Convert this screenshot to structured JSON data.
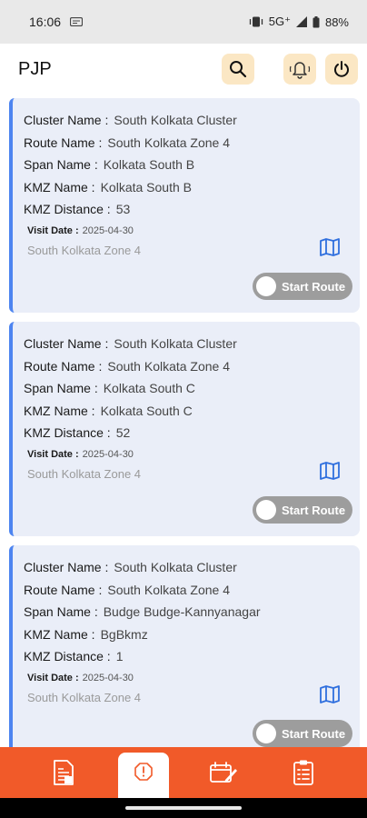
{
  "status": {
    "time": "16:06",
    "network": "5G⁺",
    "battery": "88%"
  },
  "app_bar": {
    "title": "PJP"
  },
  "cards": [
    {
      "cluster_label": "Cluster Name :",
      "cluster": "South Kolkata Cluster",
      "route_label": "Route Name :",
      "route": "South Kolkata Zone 4",
      "span_label": "Span Name :",
      "span": "Kolkata South B",
      "kmz_label": "KMZ Name :",
      "kmz": "Kolkata South B",
      "distance_label": "KMZ Distance :",
      "distance": "53",
      "visit_label": "Visit Date :",
      "visit_date": "2025-04-30",
      "zone": "South Kolkata Zone 4",
      "button": "Start Route"
    },
    {
      "cluster_label": "Cluster Name :",
      "cluster": "South Kolkata Cluster",
      "route_label": "Route Name :",
      "route": "South Kolkata Zone 4",
      "span_label": "Span Name :",
      "span": "Kolkata South C",
      "kmz_label": "KMZ Name :",
      "kmz": "Kolkata South C",
      "distance_label": "KMZ Distance :",
      "distance": "52",
      "visit_label": "Visit Date :",
      "visit_date": "2025-04-30",
      "zone": "South Kolkata Zone 4",
      "button": "Start Route"
    },
    {
      "cluster_label": "Cluster Name :",
      "cluster": "South Kolkata Cluster",
      "route_label": "Route Name :",
      "route": "South Kolkata Zone 4",
      "span_label": "Span Name :",
      "span": "Budge Budge-Kannyanagar",
      "kmz_label": "KMZ Name :",
      "kmz": "BgBkmz",
      "distance_label": "KMZ Distance :",
      "distance": "1",
      "visit_label": "Visit Date :",
      "visit_date": "2025-04-30",
      "zone": "South Kolkata Zone 4",
      "button": "Start Route"
    }
  ],
  "colors": {
    "accent": "#f15a29",
    "card_bg": "#eaeef8",
    "card_border": "#4d84f0",
    "icon_btn_bg": "#fbe7c4",
    "button_grey": "#9d9d9d"
  },
  "icons": {
    "search": "search-icon",
    "bell": "bell-icon",
    "power": "power-icon",
    "map": "map-icon",
    "nav": [
      "document-icon",
      "alert-icon",
      "edit-calendar-icon",
      "clipboard-icon"
    ]
  }
}
